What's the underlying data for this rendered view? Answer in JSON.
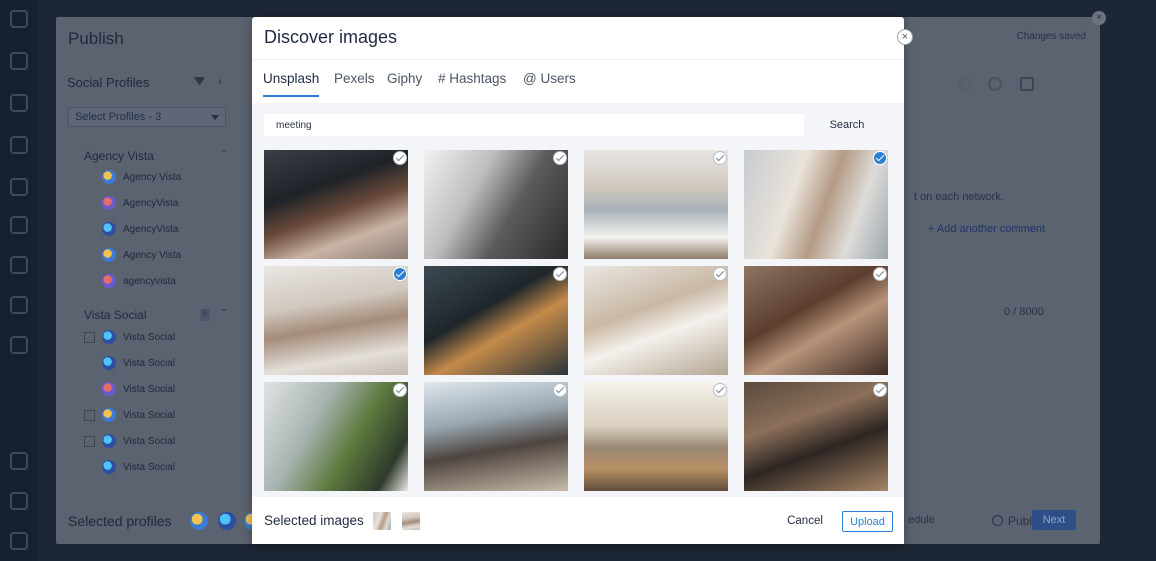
{
  "publish": {
    "title": "Publish",
    "changes_saved": "Changes saved",
    "social_profiles_heading": "Social Profiles",
    "select_profiles": "Select Profiles - 3",
    "groups": [
      {
        "name": "Agency Vista",
        "profiles": [
          "Agency Vista",
          "AgencyVista",
          "AgencyVista",
          "Agency Vista",
          "agencyvista"
        ]
      },
      {
        "name": "Vista Social",
        "count": "6",
        "profiles": [
          "Vista Social",
          "Vista Social",
          "Vista Social",
          "Vista Social",
          "Vista Social",
          "Vista Social"
        ]
      }
    ],
    "selected_profiles_label": "Selected profiles",
    "right_text": {
      "on_each_network": "t on each network.",
      "add_comment": "+ Add another comment",
      "char_count": "0 / 8000",
      "schedule": "edule",
      "publish_now": "Publish now",
      "next": "Next"
    }
  },
  "modal": {
    "title": "Discover images",
    "close_icon": "close-icon",
    "tabs": [
      {
        "label": "Unsplash",
        "active": true
      },
      {
        "label": "Pexels",
        "active": false
      },
      {
        "label": "Giphy",
        "active": false
      },
      {
        "label": "# Hashtags",
        "active": false
      },
      {
        "label": "@ Users",
        "active": false
      }
    ],
    "search": {
      "value": "meeting",
      "button": "Search"
    },
    "images": [
      {
        "selected": false
      },
      {
        "selected": false
      },
      {
        "selected": false
      },
      {
        "selected": true
      },
      {
        "selected": true
      },
      {
        "selected": false
      },
      {
        "selected": false
      },
      {
        "selected": false
      },
      {
        "selected": false
      },
      {
        "selected": false
      },
      {
        "selected": false
      },
      {
        "selected": false
      }
    ],
    "footer": {
      "selected_images_label": "Selected images",
      "selected_count": 2,
      "cancel": "Cancel",
      "upload": "Upload"
    },
    "colors": {
      "accent": "#2a7fd4",
      "title": "#1f2a44",
      "overlay": "#1d2634"
    }
  }
}
